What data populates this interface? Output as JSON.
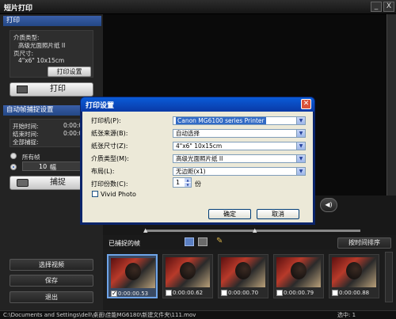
{
  "window": {
    "title": "短片打印",
    "minimize": "_",
    "close": "X"
  },
  "left_panel": {
    "print_section_header": "打印",
    "media_type_label": "介质类型:",
    "media_type_value": "高级光面照片纸 II",
    "page_size_label": "页尺寸:",
    "page_size_value": "4\"x6\" 10x15cm",
    "print_settings_button": "打印设置",
    "print_button": "打印",
    "capture_section_header": "自动帧捕捉设置",
    "start_time_label": "开始时间:",
    "start_time_value": "0:00:00",
    "end_time_label": "结束时间:",
    "end_time_value": "0:00:00",
    "capture_all_label": "全部捕捉:",
    "all_frames_label": "所有帧",
    "frame_count_value": "10",
    "frame_count_unit": "幅",
    "capture_button": "捕捉",
    "select_video_button": "选择视频",
    "save_button": "保存",
    "exit_button": "退出"
  },
  "frames_area": {
    "header": "已捕捉的帧",
    "sort_button": "按时间排序",
    "frames": [
      {
        "time": "0:00:00.53",
        "checked": true,
        "selected": true
      },
      {
        "time": "0:00:00.62",
        "checked": false,
        "selected": false
      },
      {
        "time": "0:00:00.70",
        "checked": false,
        "selected": false
      },
      {
        "time": "0:00:00.79",
        "checked": false,
        "selected": false
      },
      {
        "time": "0:00:00.88",
        "checked": false,
        "selected": false
      }
    ]
  },
  "status_bar": {
    "path": "C:\\Documents and Settings\\dell\\桌面\\佳能MG6180\\新建文件夹\\111.mov",
    "selected": "选中: 1"
  },
  "dialog": {
    "title": "打印设置",
    "printer_label": "打印机(P):",
    "printer_value": "Canon MG6100 series Printer",
    "paper_source_label": "纸张来源(B):",
    "paper_source_value": "自动选择",
    "paper_size_label": "纸张尺寸(Z):",
    "paper_size_value": "4\"x6\" 10x15cm",
    "media_type_label": "介质类型(M):",
    "media_type_value": "高级光面照片纸 II",
    "layout_label": "布局(L):",
    "layout_value": "无边距(x1)",
    "copies_label": "打印份数(C):",
    "copies_value": "1",
    "copies_unit": "份",
    "vivid_photo_label": "Vivid Photo",
    "ok_button": "确定",
    "cancel_button": "取消"
  },
  "colors": {
    "accent": "#2a59b8",
    "dialog_title": "#0a5bd8",
    "frame_selected": "#6ea4e8"
  }
}
